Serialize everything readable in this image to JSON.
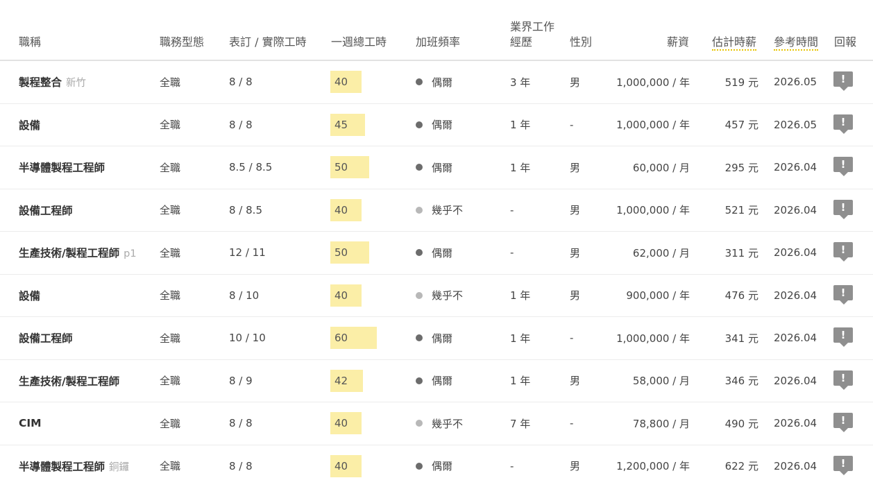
{
  "headers": {
    "title": "職稱",
    "job_type": "職務型態",
    "hours": "表訂 / 實際工時",
    "weekly": "一週總工時",
    "overtime": "加班頻率",
    "experience": "業界工作經歷",
    "gender": "性別",
    "salary": "薪資",
    "hourly": "估計時薪",
    "ref_time": "參考時間",
    "report": "回報"
  },
  "colors": {
    "hours_highlight": "#fbeea7",
    "dotted_underline": "#e8c400",
    "dot_dark": "#6c6c6c",
    "dot_light": "#b8b8b8"
  },
  "rows": [
    {
      "title": "製程整合",
      "sub": "新竹",
      "job_type": "全職",
      "hours": "8 / 8",
      "weekly": "40",
      "overtime": "偶爾",
      "overtime_level": "dark",
      "experience": "3 年",
      "gender": "男",
      "salary": "1,000,000 / 年",
      "hourly": "519 元",
      "ref_time": "2026.05",
      "report_icon": "!"
    },
    {
      "title": "設備",
      "sub": "",
      "job_type": "全職",
      "hours": "8 / 8",
      "weekly": "45",
      "overtime": "偶爾",
      "overtime_level": "dark",
      "experience": "1 年",
      "gender": "-",
      "salary": "1,000,000 / 年",
      "hourly": "457 元",
      "ref_time": "2026.05",
      "report_icon": "!"
    },
    {
      "title": "半導體製程工程師",
      "sub": "",
      "job_type": "全職",
      "hours": "8.5 / 8.5",
      "weekly": "50",
      "overtime": "偶爾",
      "overtime_level": "dark",
      "experience": "1 年",
      "gender": "男",
      "salary": "60,000 / 月",
      "hourly": "295 元",
      "ref_time": "2026.04",
      "report_icon": "!"
    },
    {
      "title": "設備工程師",
      "sub": "",
      "job_type": "全職",
      "hours": "8 / 8.5",
      "weekly": "40",
      "overtime": "幾乎不",
      "overtime_level": "light",
      "experience": "-",
      "gender": "男",
      "salary": "1,000,000 / 年",
      "hourly": "521 元",
      "ref_time": "2026.04",
      "report_icon": "!"
    },
    {
      "title": "生產技術/製程工程師",
      "sub": "p1",
      "job_type": "全職",
      "hours": "12 / 11",
      "weekly": "50",
      "overtime": "偶爾",
      "overtime_level": "dark",
      "experience": "-",
      "gender": "男",
      "salary": "62,000 / 月",
      "hourly": "311 元",
      "ref_time": "2026.04",
      "report_icon": "!"
    },
    {
      "title": "設備",
      "sub": "",
      "job_type": "全職",
      "hours": "8 / 10",
      "weekly": "40",
      "overtime": "幾乎不",
      "overtime_level": "light",
      "experience": "1 年",
      "gender": "男",
      "salary": "900,000 / 年",
      "hourly": "476 元",
      "ref_time": "2026.04",
      "report_icon": "!"
    },
    {
      "title": "設備工程師",
      "sub": "",
      "job_type": "全職",
      "hours": "10 / 10",
      "weekly": "60",
      "overtime": "偶爾",
      "overtime_level": "dark",
      "experience": "1 年",
      "gender": "-",
      "salary": "1,000,000 / 年",
      "hourly": "341 元",
      "ref_time": "2026.04",
      "report_icon": "!"
    },
    {
      "title": "生產技術/製程工程師",
      "sub": "",
      "job_type": "全職",
      "hours": "8 / 9",
      "weekly": "42",
      "overtime": "偶爾",
      "overtime_level": "dark",
      "experience": "1 年",
      "gender": "男",
      "salary": "58,000 / 月",
      "hourly": "346 元",
      "ref_time": "2026.04",
      "report_icon": "!"
    },
    {
      "title": "CIM",
      "sub": "",
      "job_type": "全職",
      "hours": "8 / 8",
      "weekly": "40",
      "overtime": "幾乎不",
      "overtime_level": "light",
      "experience": "7 年",
      "gender": "-",
      "salary": "78,800 / 月",
      "hourly": "490 元",
      "ref_time": "2026.04",
      "report_icon": "!"
    },
    {
      "title": "半導體製程工程師",
      "sub": "銅鑼",
      "job_type": "全職",
      "hours": "8 / 8",
      "weekly": "40",
      "overtime": "偶爾",
      "overtime_level": "dark",
      "experience": "-",
      "gender": "男",
      "salary": "1,200,000 / 年",
      "hourly": "622 元",
      "ref_time": "2026.04",
      "report_icon": "!"
    }
  ]
}
